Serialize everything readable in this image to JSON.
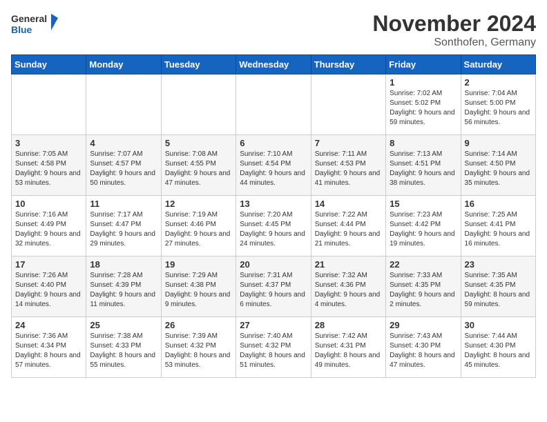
{
  "logo": {
    "line1": "General",
    "line2": "Blue"
  },
  "title": "November 2024",
  "subtitle": "Sonthofen, Germany",
  "days_header": [
    "Sunday",
    "Monday",
    "Tuesday",
    "Wednesday",
    "Thursday",
    "Friday",
    "Saturday"
  ],
  "weeks": [
    [
      {
        "day": "",
        "info": ""
      },
      {
        "day": "",
        "info": ""
      },
      {
        "day": "",
        "info": ""
      },
      {
        "day": "",
        "info": ""
      },
      {
        "day": "",
        "info": ""
      },
      {
        "day": "1",
        "info": "Sunrise: 7:02 AM\nSunset: 5:02 PM\nDaylight: 9 hours and 59 minutes."
      },
      {
        "day": "2",
        "info": "Sunrise: 7:04 AM\nSunset: 5:00 PM\nDaylight: 9 hours and 56 minutes."
      }
    ],
    [
      {
        "day": "3",
        "info": "Sunrise: 7:05 AM\nSunset: 4:58 PM\nDaylight: 9 hours and 53 minutes."
      },
      {
        "day": "4",
        "info": "Sunrise: 7:07 AM\nSunset: 4:57 PM\nDaylight: 9 hours and 50 minutes."
      },
      {
        "day": "5",
        "info": "Sunrise: 7:08 AM\nSunset: 4:55 PM\nDaylight: 9 hours and 47 minutes."
      },
      {
        "day": "6",
        "info": "Sunrise: 7:10 AM\nSunset: 4:54 PM\nDaylight: 9 hours and 44 minutes."
      },
      {
        "day": "7",
        "info": "Sunrise: 7:11 AM\nSunset: 4:53 PM\nDaylight: 9 hours and 41 minutes."
      },
      {
        "day": "8",
        "info": "Sunrise: 7:13 AM\nSunset: 4:51 PM\nDaylight: 9 hours and 38 minutes."
      },
      {
        "day": "9",
        "info": "Sunrise: 7:14 AM\nSunset: 4:50 PM\nDaylight: 9 hours and 35 minutes."
      }
    ],
    [
      {
        "day": "10",
        "info": "Sunrise: 7:16 AM\nSunset: 4:49 PM\nDaylight: 9 hours and 32 minutes."
      },
      {
        "day": "11",
        "info": "Sunrise: 7:17 AM\nSunset: 4:47 PM\nDaylight: 9 hours and 29 minutes."
      },
      {
        "day": "12",
        "info": "Sunrise: 7:19 AM\nSunset: 4:46 PM\nDaylight: 9 hours and 27 minutes."
      },
      {
        "day": "13",
        "info": "Sunrise: 7:20 AM\nSunset: 4:45 PM\nDaylight: 9 hours and 24 minutes."
      },
      {
        "day": "14",
        "info": "Sunrise: 7:22 AM\nSunset: 4:44 PM\nDaylight: 9 hours and 21 minutes."
      },
      {
        "day": "15",
        "info": "Sunrise: 7:23 AM\nSunset: 4:42 PM\nDaylight: 9 hours and 19 minutes."
      },
      {
        "day": "16",
        "info": "Sunrise: 7:25 AM\nSunset: 4:41 PM\nDaylight: 9 hours and 16 minutes."
      }
    ],
    [
      {
        "day": "17",
        "info": "Sunrise: 7:26 AM\nSunset: 4:40 PM\nDaylight: 9 hours and 14 minutes."
      },
      {
        "day": "18",
        "info": "Sunrise: 7:28 AM\nSunset: 4:39 PM\nDaylight: 9 hours and 11 minutes."
      },
      {
        "day": "19",
        "info": "Sunrise: 7:29 AM\nSunset: 4:38 PM\nDaylight: 9 hours and 9 minutes."
      },
      {
        "day": "20",
        "info": "Sunrise: 7:31 AM\nSunset: 4:37 PM\nDaylight: 9 hours and 6 minutes."
      },
      {
        "day": "21",
        "info": "Sunrise: 7:32 AM\nSunset: 4:36 PM\nDaylight: 9 hours and 4 minutes."
      },
      {
        "day": "22",
        "info": "Sunrise: 7:33 AM\nSunset: 4:35 PM\nDaylight: 9 hours and 2 minutes."
      },
      {
        "day": "23",
        "info": "Sunrise: 7:35 AM\nSunset: 4:35 PM\nDaylight: 8 hours and 59 minutes."
      }
    ],
    [
      {
        "day": "24",
        "info": "Sunrise: 7:36 AM\nSunset: 4:34 PM\nDaylight: 8 hours and 57 minutes."
      },
      {
        "day": "25",
        "info": "Sunrise: 7:38 AM\nSunset: 4:33 PM\nDaylight: 8 hours and 55 minutes."
      },
      {
        "day": "26",
        "info": "Sunrise: 7:39 AM\nSunset: 4:32 PM\nDaylight: 8 hours and 53 minutes."
      },
      {
        "day": "27",
        "info": "Sunrise: 7:40 AM\nSunset: 4:32 PM\nDaylight: 8 hours and 51 minutes."
      },
      {
        "day": "28",
        "info": "Sunrise: 7:42 AM\nSunset: 4:31 PM\nDaylight: 8 hours and 49 minutes."
      },
      {
        "day": "29",
        "info": "Sunrise: 7:43 AM\nSunset: 4:30 PM\nDaylight: 8 hours and 47 minutes."
      },
      {
        "day": "30",
        "info": "Sunrise: 7:44 AM\nSunset: 4:30 PM\nDaylight: 8 hours and 45 minutes."
      }
    ]
  ]
}
